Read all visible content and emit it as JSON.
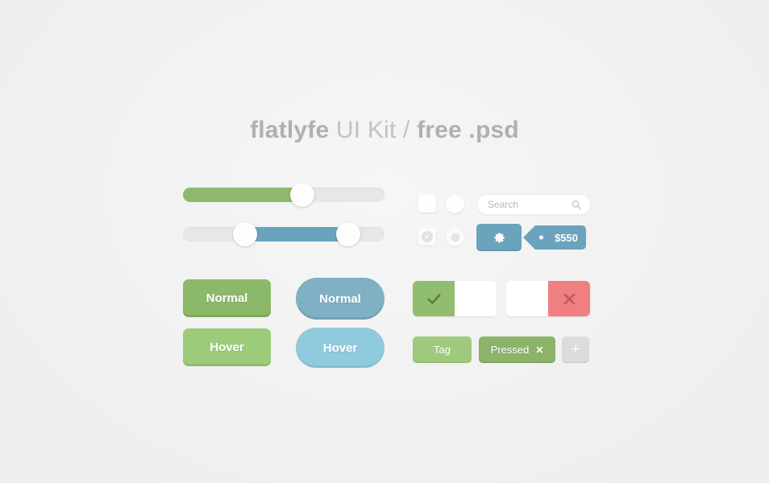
{
  "page": {
    "background_color": "#f2f2f2"
  },
  "title": {
    "part1": "flatlyfe",
    "part2": " UI Kit / ",
    "part3": "free .psd"
  },
  "sliders": [
    {
      "name": "green-slider",
      "type": "single",
      "fill_color": "#8fb96c",
      "track_color": "#e7e7e7",
      "value_percent": 59
    },
    {
      "name": "blue-range-slider",
      "type": "range",
      "fill_color": "#6ba3bd",
      "track_color": "#e7e7e7",
      "start_percent": 31,
      "end_percent": 82
    }
  ],
  "controls": {
    "checkbox_unchecked": {
      "label": "",
      "checked": false
    },
    "radio_unchecked": {
      "label": "",
      "checked": false
    },
    "checkbox_checked": {
      "label": "",
      "checked": true,
      "glyph": "✔"
    },
    "radio_checked": {
      "label": "",
      "checked": true
    }
  },
  "search": {
    "value": "",
    "placeholder": "Search",
    "icon": "search-icon"
  },
  "gear_button": {
    "icon": "gear-icon",
    "color": "#6ba3bd"
  },
  "price_tag": {
    "label": "$550",
    "color": "#6ba3bd"
  },
  "buttons": [
    {
      "label": "Normal",
      "style": "green-rect",
      "color": "#8cb86a"
    },
    {
      "label": "Hover",
      "style": "green-rect",
      "color": "#9ccb79"
    },
    {
      "label": "Normal",
      "style": "blue-pill",
      "color": "#7fb0c4"
    },
    {
      "label": "Hover",
      "style": "blue-pill",
      "color": "#8fcadd"
    }
  ],
  "toggles": {
    "confirm": {
      "active_side": "left",
      "active_color": "#91bd6f",
      "icon": "check-icon",
      "glyph": "✔"
    },
    "cancel": {
      "active_side": "right",
      "active_color": "#ef7f80",
      "icon": "close-icon",
      "glyph": "✕"
    }
  },
  "tags": [
    {
      "label": "Tag",
      "state": "normal",
      "color": "#9fca7d",
      "removable": false
    },
    {
      "label": "Pressed",
      "state": "pressed",
      "color": "#8cb36a",
      "removable": true,
      "remove_glyph": "✕"
    }
  ],
  "add_tag_button": {
    "label": "+",
    "color": "#dcdcdc"
  }
}
